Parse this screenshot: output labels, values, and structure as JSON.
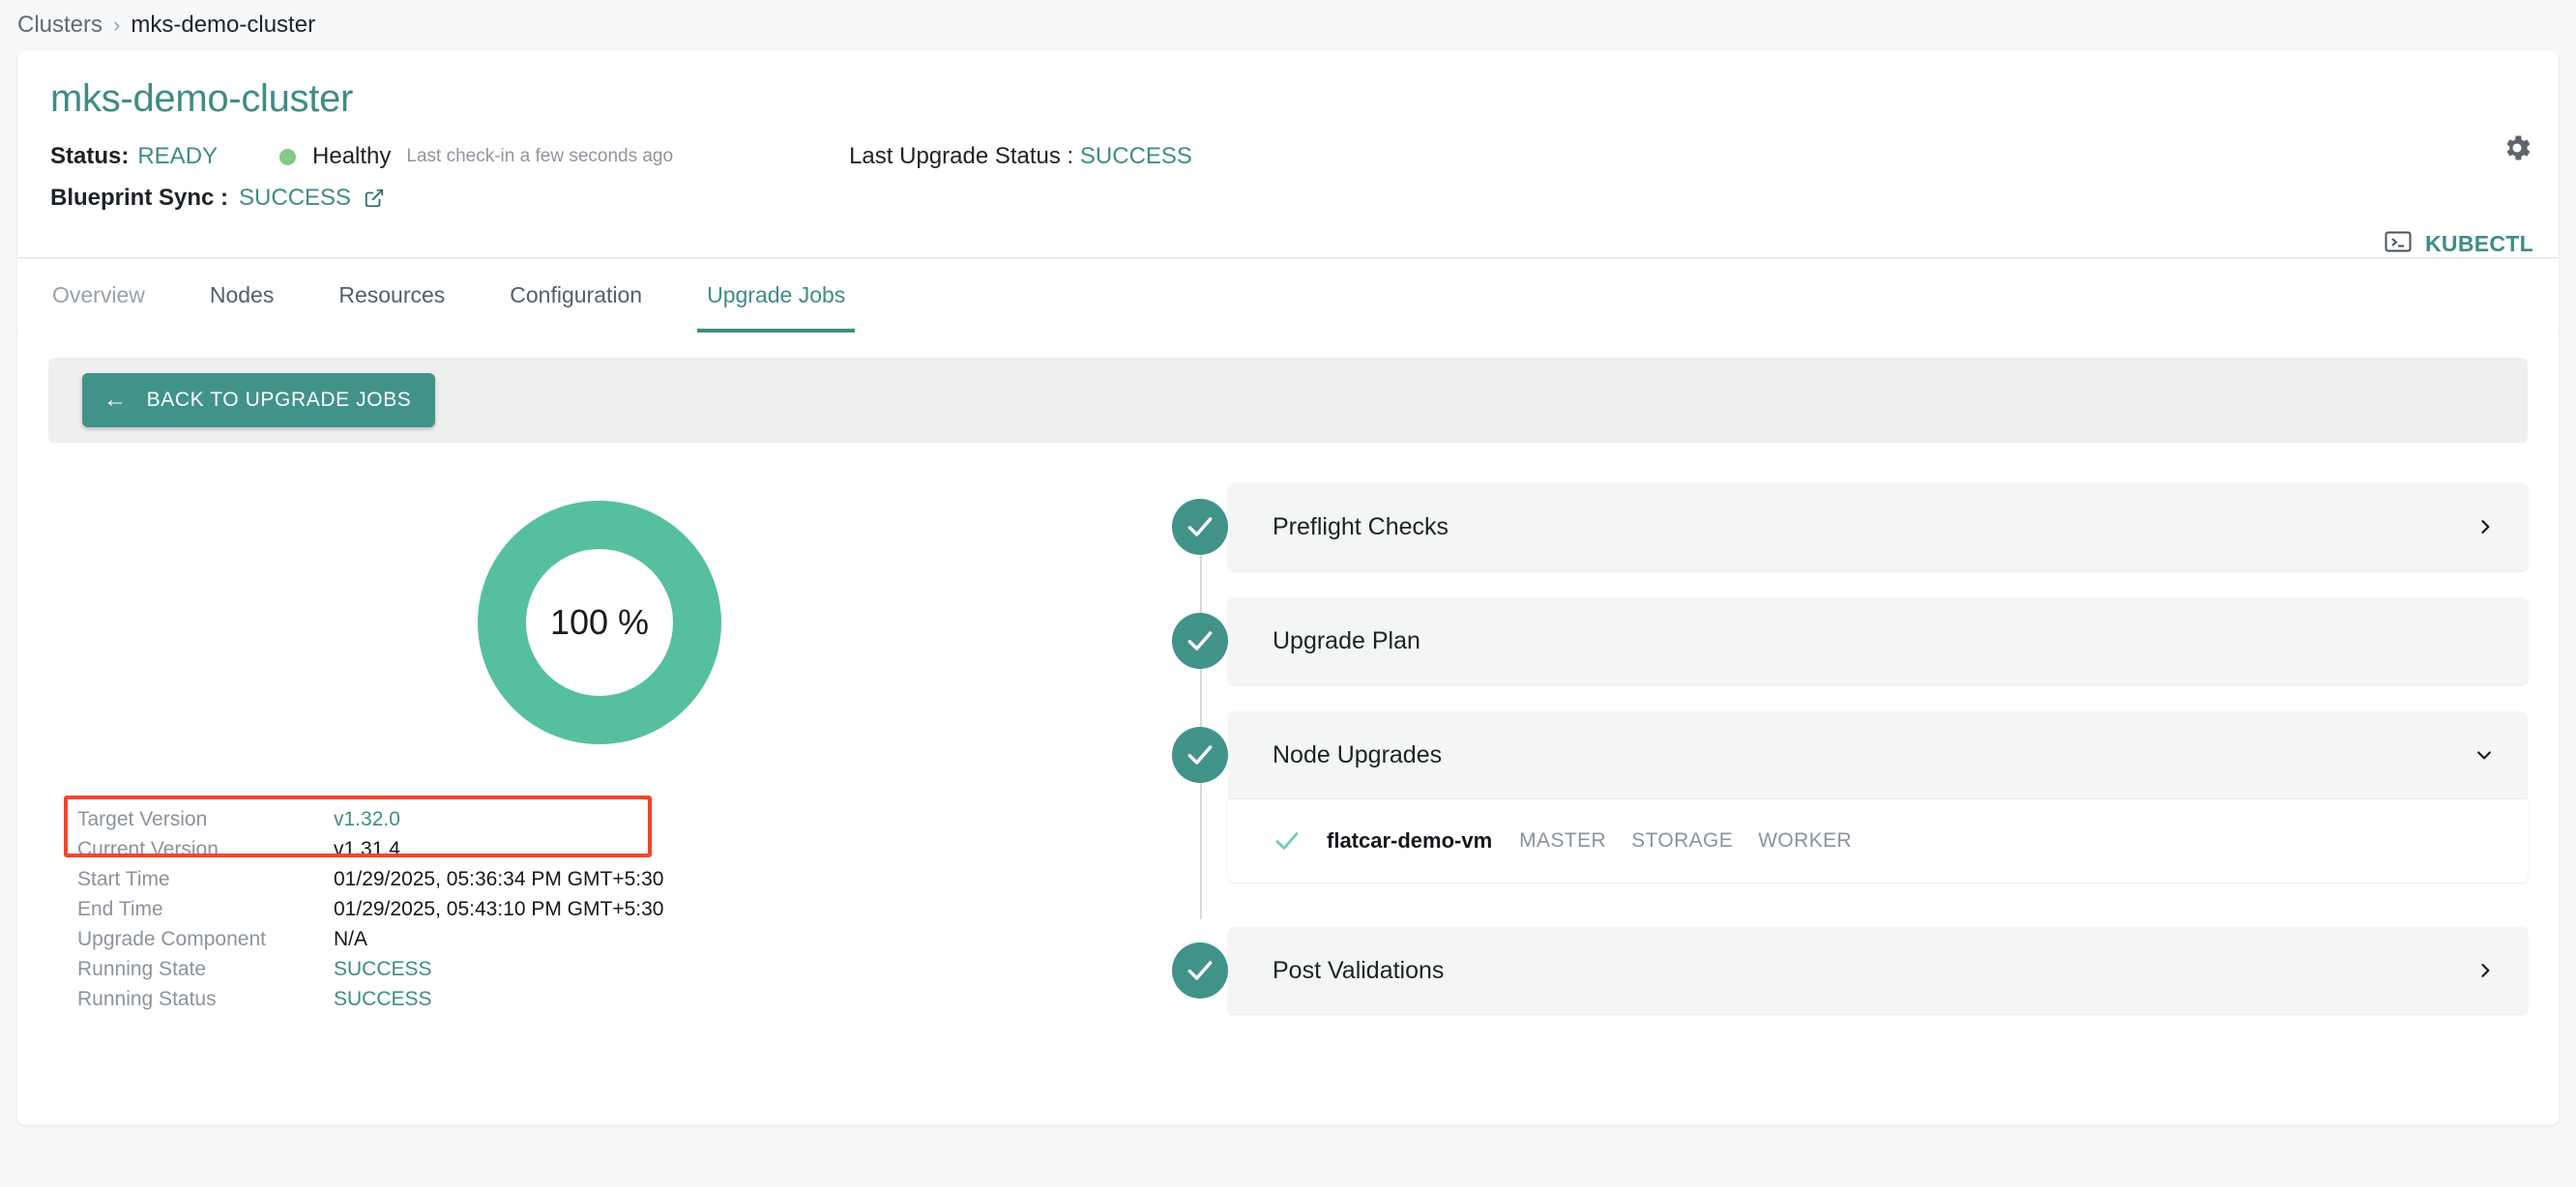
{
  "breadcrumb": {
    "root": "Clusters",
    "separator": "›",
    "current": "mks-demo-cluster"
  },
  "header": {
    "title": "mks-demo-cluster",
    "status_label": "Status:",
    "status_value": "READY",
    "health_text": "Healthy",
    "last_checkin": "Last check-in a few seconds ago",
    "last_upgrade_label": "Last Upgrade Status :",
    "last_upgrade_value": "SUCCESS",
    "blueprint_label": "Blueprint Sync :",
    "blueprint_value": "SUCCESS",
    "gear_icon": "gear-icon",
    "external_link_icon": "external-link-icon",
    "kubectl_label": "KUBECTL",
    "kubectl_icon": "terminal-icon"
  },
  "tabs": [
    {
      "label": "Overview",
      "state": "muted"
    },
    {
      "label": "Nodes",
      "state": "normal"
    },
    {
      "label": "Resources",
      "state": "normal"
    },
    {
      "label": "Configuration",
      "state": "normal"
    },
    {
      "label": "Upgrade Jobs",
      "state": "active"
    }
  ],
  "toolbar": {
    "back_label": "BACK TO UPGRADE JOBS",
    "back_arrow_icon": "arrow-left-icon"
  },
  "progress": {
    "percent_text": "100 %",
    "percent_value": 100,
    "ring_color": "#56bfa0",
    "track_color": "#ffffff"
  },
  "details": [
    {
      "label": "Target Version",
      "value": "v1.32.0",
      "accent": true,
      "highlighted": true
    },
    {
      "label": "Current Version",
      "value": "v1.31.4",
      "accent": false,
      "highlighted": true
    },
    {
      "label": "Start Time",
      "value": "01/29/2025, 05:36:34 PM GMT+5:30",
      "accent": false,
      "highlighted": false
    },
    {
      "label": "End Time",
      "value": "01/29/2025, 05:43:10 PM GMT+5:30",
      "accent": false,
      "highlighted": false
    },
    {
      "label": "Upgrade Component",
      "value": "N/A",
      "accent": false,
      "highlighted": false
    },
    {
      "label": "Running State",
      "value": "SUCCESS",
      "accent": true,
      "highlighted": false
    },
    {
      "label": "Running Status",
      "value": "SUCCESS",
      "accent": true,
      "highlighted": false
    }
  ],
  "steps": [
    {
      "title": "Preflight Checks",
      "status": "success",
      "chevron": "chevron-right-icon",
      "expanded": false
    },
    {
      "title": "Upgrade Plan",
      "status": "success",
      "chevron": "none",
      "expanded": false
    },
    {
      "title": "Node Upgrades",
      "status": "success",
      "chevron": "chevron-down-icon",
      "expanded": true
    },
    {
      "title": "Post Validations",
      "status": "success",
      "chevron": "chevron-right-icon",
      "expanded": false
    }
  ],
  "nodes": [
    {
      "name": "flatcar-demo-vm",
      "roles": [
        "MASTER",
        "STORAGE",
        "WORKER"
      ],
      "status": "success"
    }
  ],
  "colors": {
    "brand_teal": "#3f8c85",
    "badge_teal": "#41938a",
    "ring_green": "#56bfa0",
    "health_green": "#86c887",
    "highlight_red": "#f3452c",
    "muted_text": "#8b939b"
  }
}
